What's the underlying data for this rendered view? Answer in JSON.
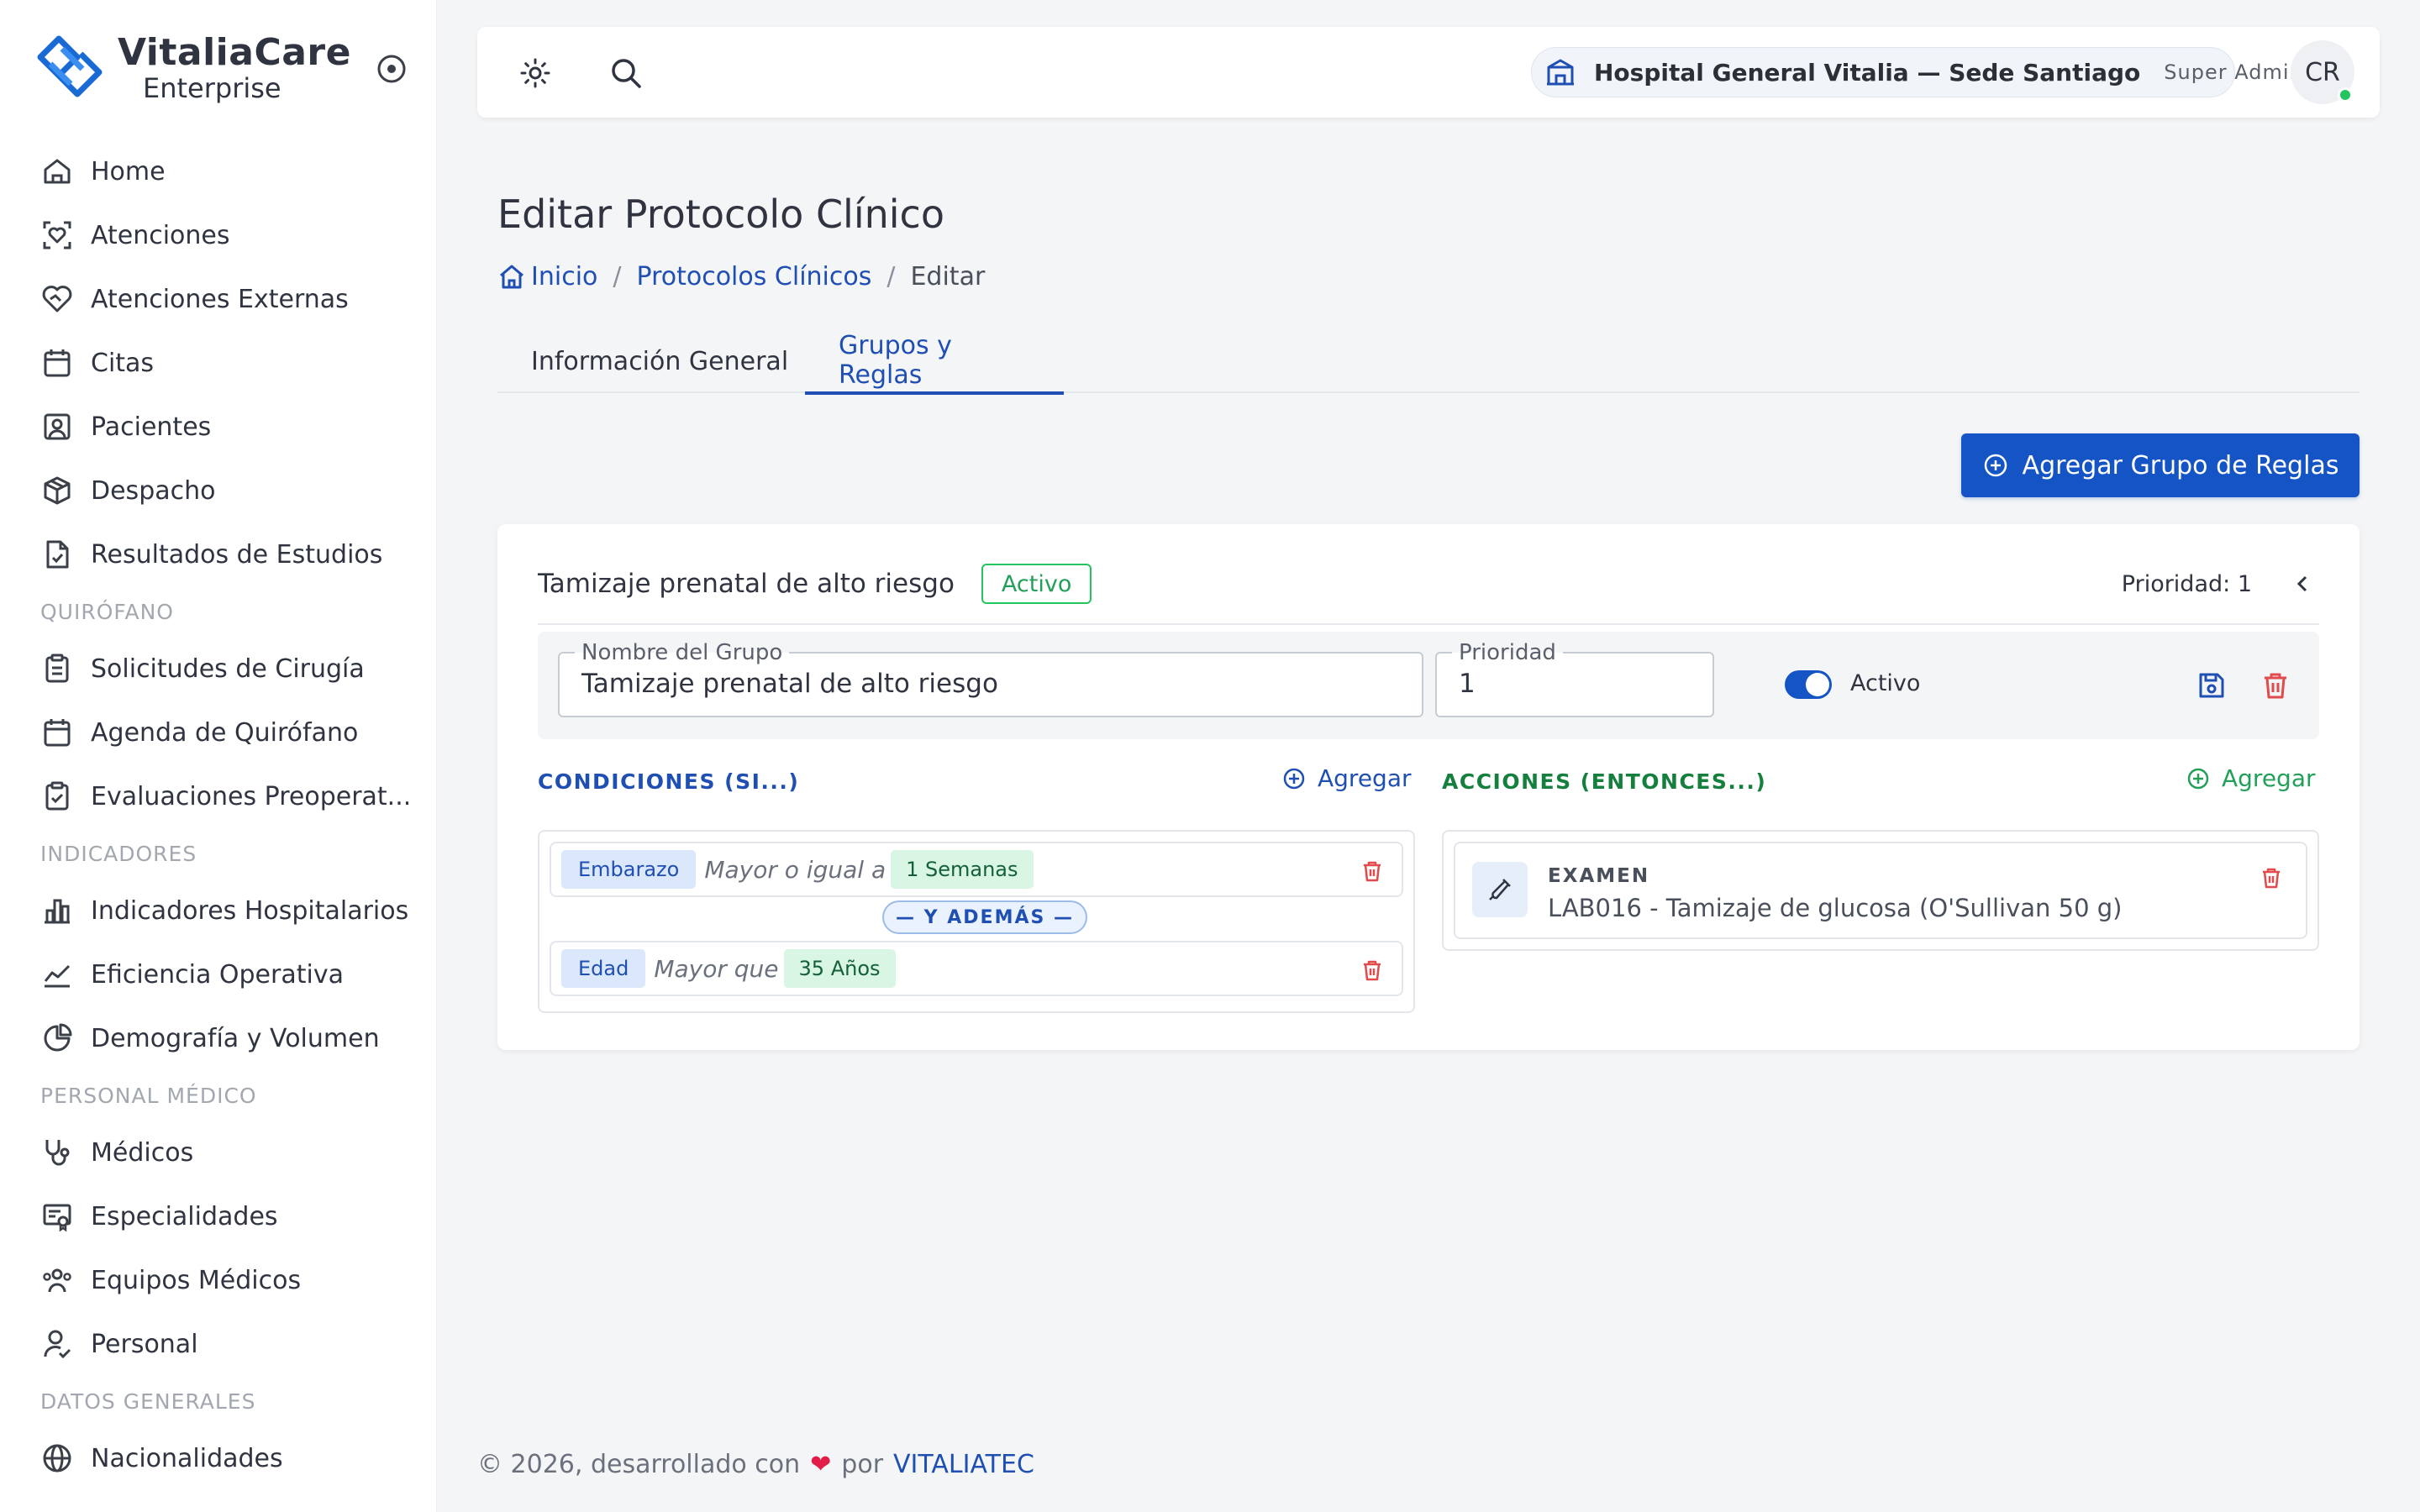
{
  "brand": {
    "name": "VitaliaCare",
    "sub": "Enterprise"
  },
  "sidebar": {
    "items": [
      {
        "label": "Home",
        "icon": "home-icon"
      },
      {
        "label": "Atenciones",
        "icon": "scan-heart-icon"
      },
      {
        "label": "Atenciones Externas",
        "icon": "handshake-heart-icon"
      },
      {
        "label": "Citas",
        "icon": "calendar-icon"
      },
      {
        "label": "Pacientes",
        "icon": "user-square-icon"
      },
      {
        "label": "Despacho",
        "icon": "package-icon"
      },
      {
        "label": "Resultados de Estudios",
        "icon": "file-check-icon"
      }
    ],
    "section_quirofano": "QUIRÓFANO",
    "items_quirofano": [
      {
        "label": "Solicitudes de Cirugía",
        "icon": "clipboard-icon"
      },
      {
        "label": "Agenda de Quirófano",
        "icon": "calendar-icon"
      },
      {
        "label": "Evaluaciones Preoperat...",
        "icon": "clipboard-check-icon"
      }
    ],
    "section_indicadores": "INDICADORES",
    "items_indicadores": [
      {
        "label": "Indicadores Hospitalarios",
        "icon": "bar-chart-icon"
      },
      {
        "label": "Eficiencia Operativa",
        "icon": "line-chart-icon"
      },
      {
        "label": "Demografía y Volumen",
        "icon": "pie-chart-icon"
      }
    ],
    "section_personal": "PERSONAL MÉDICO",
    "items_personal": [
      {
        "label": "Médicos",
        "icon": "stethoscope-icon"
      },
      {
        "label": "Especialidades",
        "icon": "certificate-icon"
      },
      {
        "label": "Equipos Médicos",
        "icon": "users-group-icon"
      },
      {
        "label": "Personal",
        "icon": "user-check-icon"
      }
    ],
    "section_datos": "DATOS GENERALES",
    "items_datos": [
      {
        "label": "Nacionalidades",
        "icon": "globe-icon"
      }
    ]
  },
  "topbar": {
    "tenant_name": "Hospital General Vitalia — Sede Santiago",
    "role": "Super Admin",
    "avatar": "CR"
  },
  "page": {
    "title": "Editar Protocolo Clínico",
    "breadcrumb": {
      "home": "Inicio",
      "parent": "Protocolos Clínicos",
      "current": "Editar"
    },
    "tabs": [
      "Información General",
      "Grupos y Reglas"
    ],
    "active_tab": "Grupos y Reglas",
    "add_group_label": "Agregar Grupo de Reglas"
  },
  "group": {
    "title": "Tamizaje prenatal de alto riesgo",
    "status": "Activo",
    "priority_label": "Prioridad: 1",
    "name_label": "Nombre del Grupo",
    "name_value": "Tamizaje prenatal de alto riesgo",
    "priority_field_label": "Prioridad",
    "priority_value": "1",
    "toggle_label": "Activo",
    "toggle_on": true,
    "conditions_title": "CONDICIONES (SI...)",
    "conditions_add": "Agregar",
    "actions_title": "ACCIONES (ENTONCES...)",
    "actions_add": "Agregar",
    "conditions": [
      {
        "variable": "Embarazo",
        "operator": "Mayor o igual a",
        "value": "1 Semanas"
      },
      {
        "variable": "Edad",
        "operator": "Mayor que",
        "value": "35 Años"
      }
    ],
    "connector": "— Y ADEMÁS —",
    "actions": [
      {
        "type": "EXAMEN",
        "value": "LAB016 - Tamizaje de glucosa (O'Sullivan 50 g)"
      }
    ]
  },
  "footer": {
    "text": "© 2026, desarrollado con",
    "by": "por",
    "link": "VITALIATEC"
  },
  "colors": {
    "primary": "#1554c4",
    "link": "#1f4fb2",
    "success": "#22c55e",
    "danger": "#e14b4b"
  }
}
